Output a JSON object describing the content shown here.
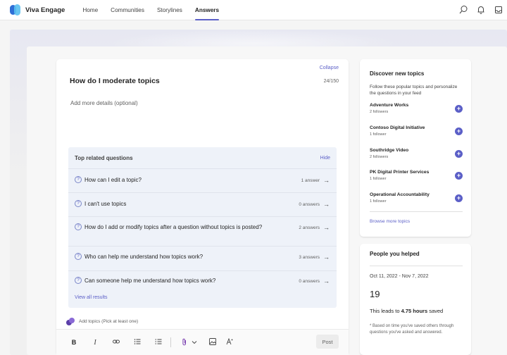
{
  "app": {
    "name": "Viva Engage"
  },
  "nav": {
    "items": [
      {
        "label": "Home"
      },
      {
        "label": "Communities"
      },
      {
        "label": "Storylines"
      },
      {
        "label": "Answers"
      }
    ],
    "active": "Answers"
  },
  "question": {
    "collapse_label": "Collapse",
    "title": "How do I moderate topics",
    "char_count": "24/150",
    "details_placeholder": "Add more details (optional)",
    "related": {
      "heading": "Top related questions",
      "hide_label": "Hide",
      "items": [
        {
          "text": "How can I edit a topic?",
          "answers": "1 answer"
        },
        {
          "text": "I can't use topics",
          "answers": "0 answers"
        },
        {
          "text": "How do I add or modify topics after a question without topics is posted?",
          "answers": "2 answers"
        },
        {
          "text": "Who can help me understand how topics work?",
          "answers": "3 answers"
        },
        {
          "text": "Can someone help me understand how topics work?",
          "answers": "0 answers"
        }
      ],
      "view_all": "View all results"
    },
    "add_topics": "Add topics (Pick at least one)",
    "post_label": "Post"
  },
  "discover": {
    "title": "Discover new topics",
    "description": "Follow these popular topics and personalize the questions in your feed",
    "topics": [
      {
        "name": "Adventure Works",
        "followers": "2 followers"
      },
      {
        "name": "Contoso Digital Initiative",
        "followers": "1 follower"
      },
      {
        "name": "Southridge Video",
        "followers": "2 followers"
      },
      {
        "name": "PK Digital Printer Services",
        "followers": "1 follower"
      },
      {
        "name": "Operational Accountability",
        "followers": "1 follower"
      }
    ],
    "browse_label": "Browse more topics"
  },
  "helped": {
    "title": "People you helped",
    "date_range": "Oct 11, 2022 - Nov 7, 2022",
    "count": "19",
    "leads_prefix": "This leads to ",
    "leads_hours": "4.75 hours",
    "leads_suffix": " saved",
    "footnote": "* Based on time you've saved others through questions you've asked and answered."
  },
  "colors": {
    "accent": "#5b5fc7",
    "related_bg": "#eef2f9"
  }
}
